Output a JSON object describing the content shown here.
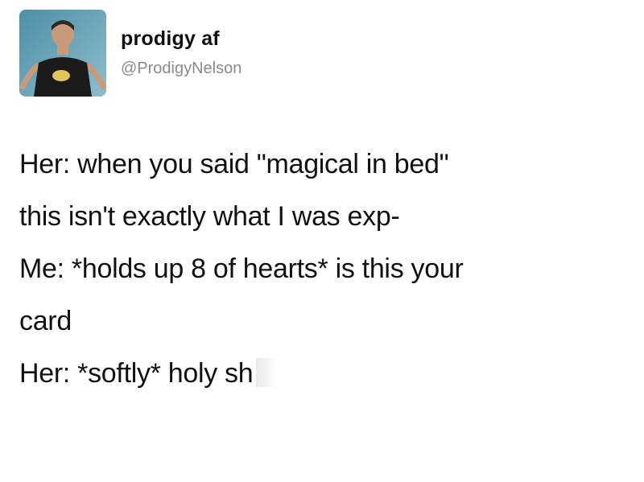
{
  "author": {
    "display_name": "prodigy af",
    "handle": "@ProdigyNelson",
    "avatar_icon": "profile-photo-icon"
  },
  "tweet": {
    "lines": [
      "Her: when you said \"magical in bed\"",
      "this isn't exactly what I was exp-",
      "Me: *holds up 8 of hearts* is this your",
      "card",
      "Her: *softly* holy sh"
    ]
  },
  "colors": {
    "text": "#111111",
    "handle": "#8a8a8a",
    "background": "#ffffff"
  }
}
